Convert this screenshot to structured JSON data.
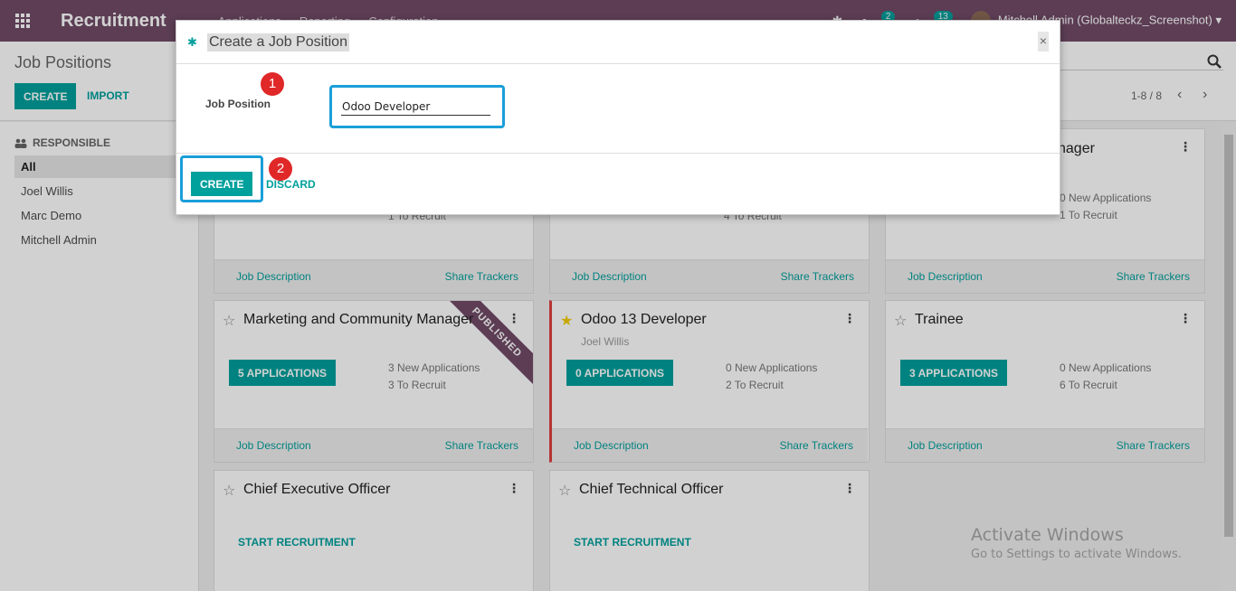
{
  "app": {
    "title": "Recruitment",
    "menu": [
      "Applications",
      "Reporting",
      "Configuration"
    ]
  },
  "topbar": {
    "messages_count": "2",
    "activities_count": "13",
    "user": "Mitchell Admin (Globalteckz_Screenshot)"
  },
  "control_panel": {
    "title": "Job Positions",
    "create_label": "CREATE",
    "import_label": "IMPORT",
    "pager": "1-8 / 8",
    "search_placeholder": ""
  },
  "sidebar": {
    "heading": "RESPONSIBLE",
    "items": [
      {
        "label": "All",
        "active": true
      },
      {
        "label": "Joel Willis",
        "active": false
      },
      {
        "label": "Marc Demo",
        "active": false
      },
      {
        "label": "Mitchell Admin",
        "active": false
      }
    ]
  },
  "cards": [
    {
      "title": "",
      "stat1": "",
      "stat2": "1 To Recruit",
      "foot_left": "Job Description",
      "foot_right": "Share Trackers"
    },
    {
      "title": "",
      "stat1": "",
      "stat2": "4 To Recruit",
      "foot_left": "Job Description",
      "foot_right": "Share Trackers"
    },
    {
      "title": "nager",
      "stat1": "0 New Applications",
      "stat2": "1 To Recruit",
      "foot_left": "Job Description",
      "foot_right": "Share Trackers"
    },
    {
      "title": "Marketing and Community Manager",
      "apps": "5 APPLICATIONS",
      "stat1": "3 New Applications",
      "stat2": "3 To Recruit",
      "foot_left": "Job Description",
      "foot_right": "Share Trackers",
      "ribbon": "PUBLISHED"
    },
    {
      "title": "Odoo 13 Developer",
      "subtitle": "Joel Willis",
      "apps": "0 APPLICATIONS",
      "stat1": "0 New Applications",
      "stat2": "2 To Recruit",
      "foot_left": "Job Description",
      "foot_right": "Share Trackers",
      "favorite": true
    },
    {
      "title": "Trainee",
      "apps": "3 APPLICATIONS",
      "stat1": "0 New Applications",
      "stat2": "6 To Recruit",
      "foot_left": "Job Description",
      "foot_right": "Share Trackers"
    },
    {
      "title": "Chief Executive Officer",
      "action": "START RECRUITMENT"
    },
    {
      "title": "Chief Technical Officer",
      "action": "START RECRUITMENT"
    }
  ],
  "dialog": {
    "title": "Create a Job Position",
    "field_label": "Job Position",
    "field_value": "Odoo Developer",
    "create_label": "CREATE",
    "discard_label": "DISCARD"
  },
  "annotations": {
    "step1": "1",
    "step2": "2",
    "highlight_color": "#1a9ed9",
    "marker_color": "#e02828"
  },
  "watermark": {
    "line1": "Activate Windows",
    "line2": "Go to Settings to activate Windows."
  },
  "colors": {
    "brand": "#714B67",
    "accent": "#00A09D"
  }
}
